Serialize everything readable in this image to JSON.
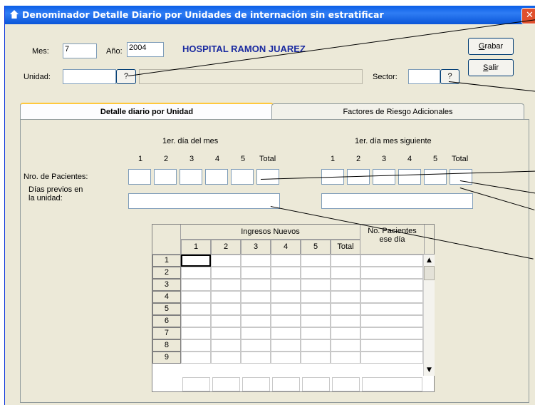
{
  "window": {
    "title": "Denominador Detalle Diario por Unidades de internación sin estratificar",
    "close": "✕"
  },
  "form": {
    "mes_label": "Mes:",
    "mes_value": "7",
    "anio_label": "Año:",
    "anio_value": "2004",
    "hospital": "HOSPITAL RAMON JUAREZ",
    "unidad_label": "Unidad:",
    "unidad_value": "",
    "unidad_lookup": "?",
    "sector_label": "Sector:",
    "sector_value": "",
    "sector_lookup": "?",
    "grabar_first": "G",
    "grabar_rest": "rabar",
    "salir_first": "S",
    "salir_rest": "alir"
  },
  "tabs": [
    {
      "label": "Detalle diario por Unidad",
      "active": true
    },
    {
      "label": "Factores de Riesgo Adicionales",
      "active": false
    }
  ],
  "detail": {
    "group1_title": "1er. día del mes",
    "group2_title": "1er. día mes siguiente",
    "cols": [
      "1",
      "2",
      "3",
      "4",
      "5",
      "Total"
    ],
    "row1_label": "Nro. de Pacientes:",
    "row2_label_line1": "Días previos en",
    "row2_label_line2": "la unidad:"
  },
  "grid": {
    "group_header": "Ingresos Nuevos",
    "cols": [
      "1",
      "2",
      "3",
      "4",
      "5",
      "Total"
    ],
    "extra_header_line1": "No. Pacientes",
    "extra_header_line2": "ese día",
    "rows": [
      "1",
      "2",
      "3",
      "4",
      "5",
      "6",
      "7",
      "8",
      "9"
    ]
  }
}
